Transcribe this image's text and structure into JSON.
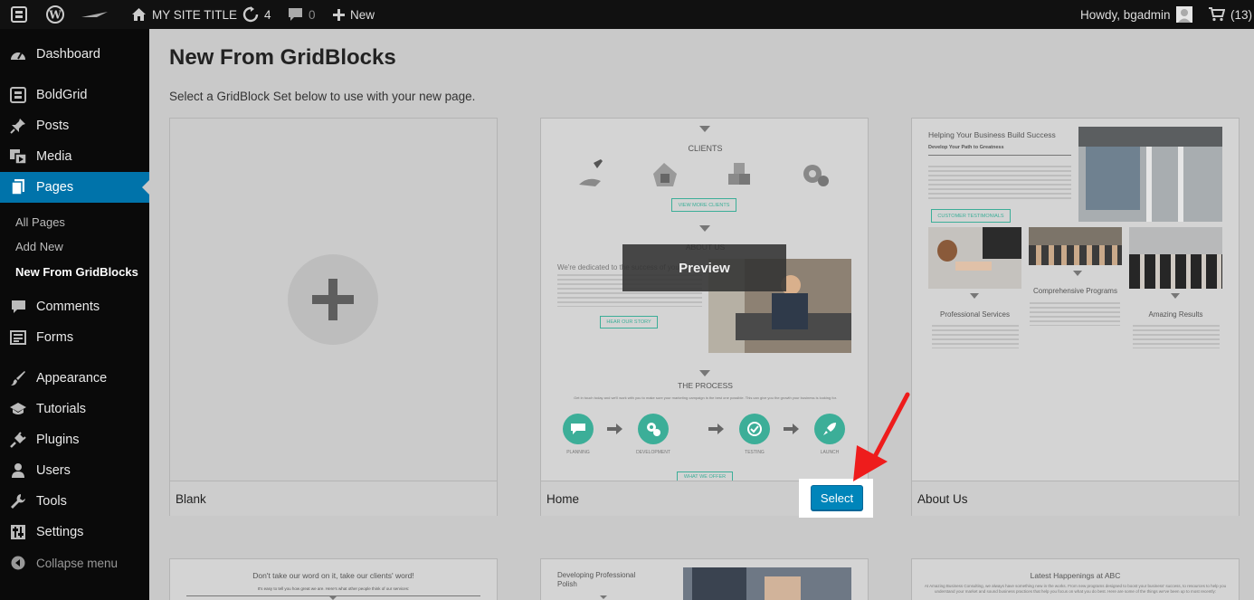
{
  "adminbar": {
    "site_title": "MY SITE TITLE",
    "updates_count": "4",
    "comments_count": "0",
    "new_label": "New",
    "howdy": "Howdy, bgadmin",
    "cart_count": "(13)"
  },
  "sidebar": {
    "items": [
      {
        "label": "Dashboard",
        "icon": "dashboard-icon"
      },
      {
        "label": "BoldGrid",
        "icon": "boldgrid-icon"
      },
      {
        "label": "Posts",
        "icon": "pin-icon"
      },
      {
        "label": "Media",
        "icon": "media-icon"
      },
      {
        "label": "Pages",
        "icon": "pages-icon"
      },
      {
        "label": "Comments",
        "icon": "comment-icon"
      },
      {
        "label": "Forms",
        "icon": "forms-icon"
      },
      {
        "label": "Appearance",
        "icon": "brush-icon"
      },
      {
        "label": "Tutorials",
        "icon": "graduation-cap-icon"
      },
      {
        "label": "Plugins",
        "icon": "plug-icon"
      },
      {
        "label": "Users",
        "icon": "user-icon"
      },
      {
        "label": "Tools",
        "icon": "wrench-icon"
      },
      {
        "label": "Settings",
        "icon": "settings-icon"
      }
    ],
    "submenu": [
      "All Pages",
      "Add New",
      "New From GridBlocks"
    ],
    "collapse": "Collapse menu"
  },
  "main": {
    "title": "New From GridBlocks",
    "subtitle": "Select a GridBlock Set below to use with your new page.",
    "cards": [
      {
        "name": "Blank"
      },
      {
        "name": "Home"
      },
      {
        "name": "About Us"
      }
    ],
    "preview_label": "Preview",
    "select_label": "Select"
  },
  "home_thumb": {
    "clients": "CLIENTS",
    "view_more": "VIEW MORE CLIENTS",
    "about": "ABOUT US",
    "dedicated": "We're dedicated to the success of your b",
    "hear_story": "HEAR OUR STORY",
    "process": "THE PROCESS",
    "process_text": "Get in touch today and we'll work with you to make sure your marketing campaign is the best one possible. This can give you the growth your business is looking for.",
    "steps": [
      "PLANNING",
      "DEVELOPMENT",
      "TESTING",
      "LAUNCH"
    ],
    "what_we_offer": "WHAT WE OFFER"
  },
  "about_thumb": {
    "heading": "Helping Your Business Build Success",
    "subheading": "Develop Your Path to Greatness",
    "testimonials": "CUSTOMER TESTIMONIALS",
    "col1": "Professional Services",
    "col2": "Comprehensive Programs",
    "col3": "Amazing Results"
  },
  "row2": {
    "card1_heading": "Don't take our word on it, take our clients' word!",
    "card1_sub": "It's easy to tell you how great we are. Here's what other people think of our services:",
    "card2_heading": "Developing Professional Polish",
    "card3_heading": "Latest Happenings at ABC",
    "card3_text": "At Amazing Business Consulting, we always have something new in the works. From new programs designed to boost your business' success, to resources to help you understand your market and sound business practices that help you focus on what you do best. Here are some of the things we've been up to most recently:"
  },
  "colors": {
    "adminbar": "#111111",
    "sidebar": "#0a0a0a",
    "active": "#0073aa",
    "teal": "#3cae98",
    "arrow": "#ee1c1c"
  }
}
